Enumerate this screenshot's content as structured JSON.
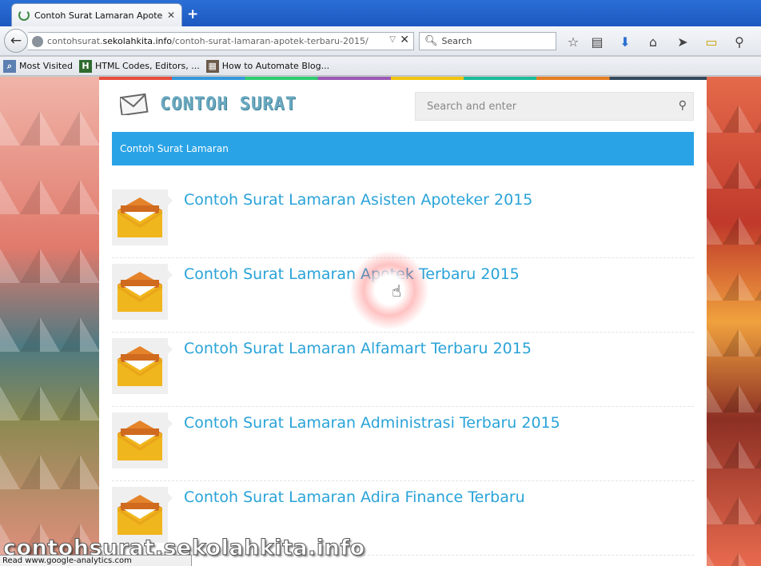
{
  "browser": {
    "tab_title": "Contoh Surat Lamaran Apote...",
    "url_prefix": "contohsurat.",
    "url_domain": "sekolahkita.info",
    "url_path": "/contoh-surat-lamaran-apotek-terbaru-2015/",
    "search_placeholder": "Search",
    "bookmarks": [
      "Most Visited",
      "HTML Codes, Editors, ...",
      "How to Automate Blog..."
    ],
    "status_text": "Read www.google-analytics.com"
  },
  "site": {
    "logo_text": "CONTOH SURAT",
    "search_placeholder": "Search and enter",
    "category_label": "Contoh Surat Lamaran"
  },
  "posts": [
    {
      "title": "Contoh Surat Lamaran Asisten Apoteker 2015"
    },
    {
      "title": "Contoh Surat Lamaran Apotek Terbaru 2015"
    },
    {
      "title": "Contoh Surat Lamaran Alfamart Terbaru 2015"
    },
    {
      "title": "Contoh Surat Lamaran Administrasi Terbaru 2015"
    },
    {
      "title": "Contoh Surat Lamaran Adira Finance Terbaru"
    }
  ],
  "watermark": "contohsurat.sekolahkita.info",
  "colors": {
    "accent": "#29a3e6",
    "link": "#29a3d8"
  }
}
